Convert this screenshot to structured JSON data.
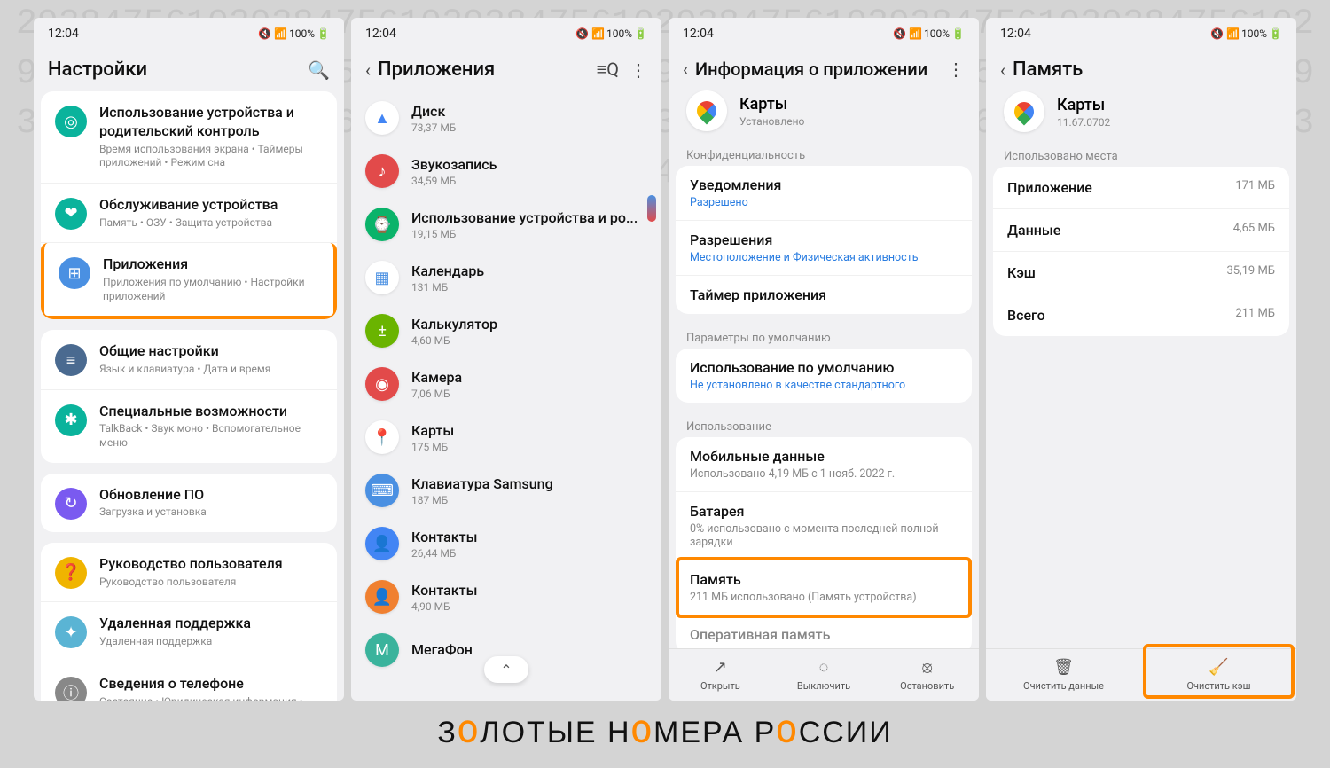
{
  "status": {
    "time": "12:04",
    "battery": "100%"
  },
  "screen1": {
    "title": "Настройки",
    "groups": [
      [
        {
          "icon_bg": "#0ab39c",
          "icon": "◎",
          "title": "Использование устройства и родительский контроль",
          "sub": "Время использования экрана  •  Таймеры приложений  •  Режим сна"
        },
        {
          "icon_bg": "#0ab39c",
          "icon": "❤",
          "title": "Обслуживание устройства",
          "sub": "Память  •  ОЗУ  •  Защита устройства"
        },
        {
          "icon_bg": "#4a90e2",
          "icon": "⊞",
          "title": "Приложения",
          "sub": "Приложения по умолчанию  •  Настройки приложений",
          "hl": true
        }
      ],
      [
        {
          "icon_bg": "#4a6a90",
          "icon": "≡",
          "title": "Общие настройки",
          "sub": "Язык и клавиатура  •  Дата и время"
        },
        {
          "icon_bg": "#0ab39c",
          "icon": "✱",
          "title": "Специальные возможности",
          "sub": "TalkBack  •  Звук моно  •  Вспомогательное меню"
        }
      ],
      [
        {
          "icon_bg": "#7a5af0",
          "icon": "↻",
          "title": "Обновление ПО",
          "sub": "Загрузка и установка"
        }
      ],
      [
        {
          "icon_bg": "#f0b400",
          "icon": "❓",
          "title": "Руководство пользователя",
          "sub": "Руководство пользователя"
        },
        {
          "icon_bg": "#5ab4d4",
          "icon": "✦",
          "title": "Удаленная поддержка",
          "sub": "Удаленная поддержка"
        },
        {
          "icon_bg": "#888",
          "icon": "ⓘ",
          "title": "Сведения о телефоне",
          "sub": "Состояние  •  Юридическая информация  •  Имя телефона"
        }
      ]
    ]
  },
  "screen2": {
    "title": "Приложения",
    "apps": [
      {
        "bg": "#fff",
        "fg": "#4285f4",
        "glyph": "▲",
        "name": "Диск",
        "size": "73,37 МБ"
      },
      {
        "bg": "#e24a4a",
        "fg": "#fff",
        "glyph": "♪",
        "name": "Звукозапись",
        "size": "34,59 МБ"
      },
      {
        "bg": "#0ab36a",
        "fg": "#fff",
        "glyph": "⌚",
        "name": "Использование устройства и ро...",
        "size": "19,15 МБ"
      },
      {
        "bg": "#fff",
        "fg": "#4a90e2",
        "glyph": "▦",
        "name": "Календарь",
        "size": "131 МБ"
      },
      {
        "bg": "#6ab400",
        "fg": "#fff",
        "glyph": "±",
        "name": "Калькулятор",
        "size": "4,60 МБ"
      },
      {
        "bg": "#e24a4a",
        "fg": "#fff",
        "glyph": "◉",
        "name": "Камера",
        "size": "7,06 МБ"
      },
      {
        "bg": "#fff",
        "fg": "#4285f4",
        "glyph": "📍",
        "name": "Карты",
        "size": "175 МБ"
      },
      {
        "bg": "#4a90e2",
        "fg": "#fff",
        "glyph": "⌨",
        "name": "Клавиатура Samsung",
        "size": "187 МБ"
      },
      {
        "bg": "#4285f4",
        "fg": "#fff",
        "glyph": "👤",
        "name": "Контакты",
        "size": "26,44 МБ"
      },
      {
        "bg": "#f08030",
        "fg": "#fff",
        "glyph": "👤",
        "name": "Контакты",
        "size": "4,90 МБ"
      },
      {
        "bg": "#3ab39c",
        "fg": "#fff",
        "glyph": "M",
        "name": "МегаФон",
        "size": ""
      }
    ]
  },
  "screen3": {
    "title": "Информация о приложении",
    "app_name": "Карты",
    "app_status": "Установлено",
    "confidentiality_label": "Конфиденциальность",
    "notif": {
      "title": "Уведомления",
      "sub": "Разрешено"
    },
    "perm": {
      "title": "Разрешения",
      "sub": "Местоположение и Физическая активность"
    },
    "timer": {
      "title": "Таймер приложения"
    },
    "defaults_label": "Параметры по умолчанию",
    "defaults": {
      "title": "Использование по умолчанию",
      "sub": "Не установлено в качестве стандартного"
    },
    "usage_label": "Использование",
    "mobile": {
      "title": "Мобильные данные",
      "sub": "Использовано 4,19 МБ с 1 нояб. 2022 г."
    },
    "battery": {
      "title": "Батарея",
      "sub": "0% использовано с момента последней полной зарядки"
    },
    "memory": {
      "title": "Память",
      "sub": "211 МБ использовано (Память устройства)"
    },
    "ram_cut": "Оперативная память",
    "btns": {
      "open": "Открыть",
      "off": "Выключить",
      "stop": "Остановить"
    }
  },
  "screen4": {
    "title": "Память",
    "app_name": "Карты",
    "app_ver": "11.67.0702",
    "used_label": "Использовано места",
    "rows": [
      {
        "label": "Приложение",
        "val": "171 МБ"
      },
      {
        "label": "Данные",
        "val": "4,65 МБ"
      },
      {
        "label": "Кэш",
        "val": "35,19 МБ"
      },
      {
        "label": "Всего",
        "val": "211 МБ"
      }
    ],
    "btns": {
      "data": "Очистить данные",
      "cache": "Очистить кэш"
    }
  },
  "footer": "ЛОТЫЕ Н МЕРА Р ССИИ"
}
